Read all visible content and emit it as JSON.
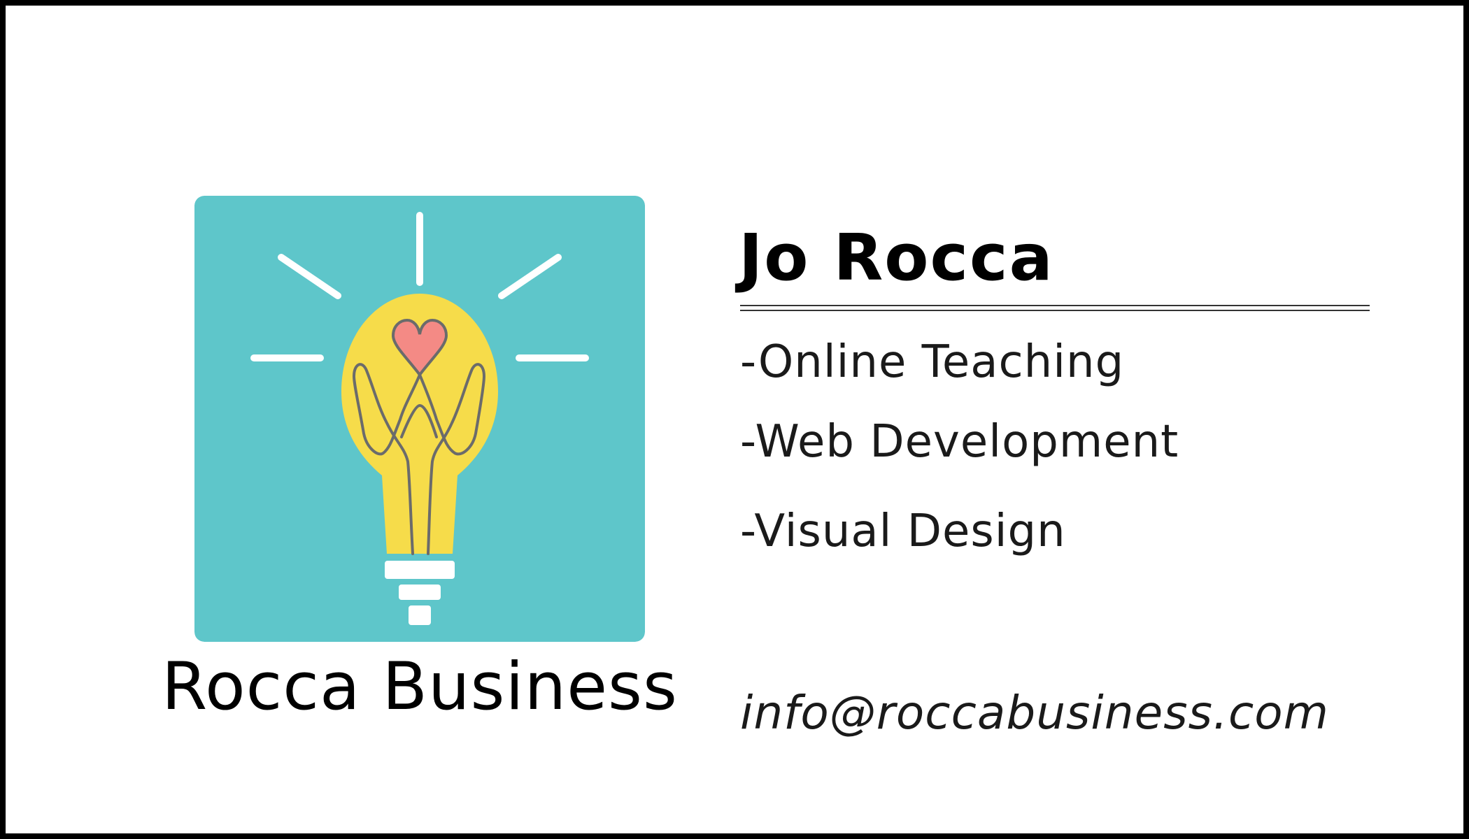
{
  "card": {
    "person_name": "Jo Rocca",
    "company_name": "Rocca Business",
    "services": [
      "-Online Teaching",
      "-Web Development",
      "-Visual Design"
    ],
    "email": "info@roccabusiness.com"
  },
  "logo": {
    "icon": "lightbulb-heart-icon",
    "background_color": "#5EC6CA",
    "bulb_color": "#F6DC4A",
    "heart_color": "#F48A85",
    "ray_color": "#FFFFFF"
  },
  "colors": {
    "border": "#000000",
    "text": "#000000",
    "rule": "#333333"
  }
}
